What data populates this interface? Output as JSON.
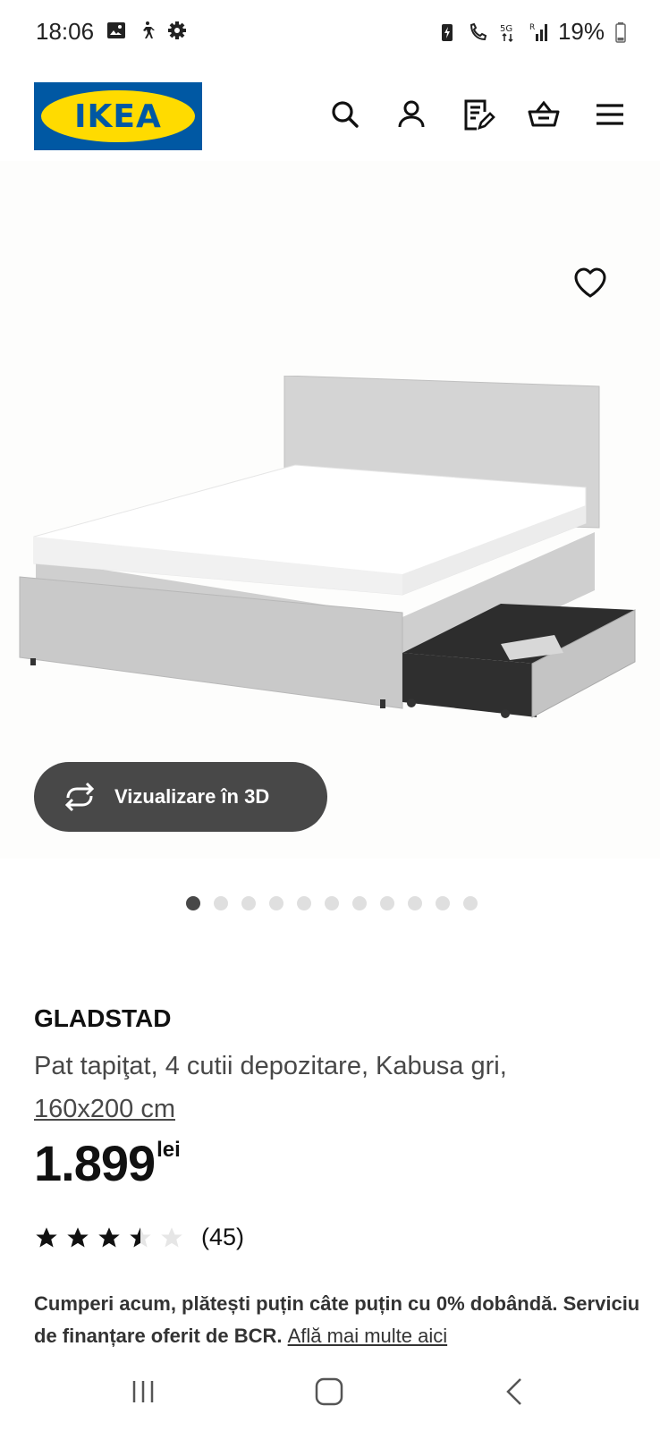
{
  "status_bar": {
    "time": "18:06",
    "battery": "19%",
    "left_icons": [
      "gallery-icon",
      "walking-icon",
      "gear-icon"
    ],
    "right_icons": [
      "battery-saver-icon",
      "wifi-call-icon",
      "5g-icon",
      "signal-icon",
      "battery-icon"
    ]
  },
  "header": {
    "logo_text": "IKEA",
    "icons": [
      "search-icon",
      "account-icon",
      "shopping-list-icon",
      "cart-icon",
      "menu-icon"
    ],
    "brand_colors": {
      "blue": "#0058a3",
      "yellow": "#ffdb00"
    }
  },
  "gallery": {
    "view_3d_label": "Vizualizare în 3D",
    "image_count": 11,
    "active_index": 0
  },
  "product": {
    "name": "GLADSTAD",
    "description": "Pat tapiţat, 4 cutii depozitare, Kabusa gri,",
    "size": "160x200 cm",
    "price": "1.899",
    "currency": "lei",
    "rating": 3.5,
    "rating_max": 5,
    "review_count": "(45)"
  },
  "finance": {
    "text": "Cumperi acum, plătești puțin câte puțin cu 0% dobândă. Serviciu de finanțare oferit de BCR.",
    "link": "Află mai multe aici"
  },
  "nav_bar": {
    "icons": [
      "recent-apps-icon",
      "home-icon",
      "back-icon"
    ]
  }
}
